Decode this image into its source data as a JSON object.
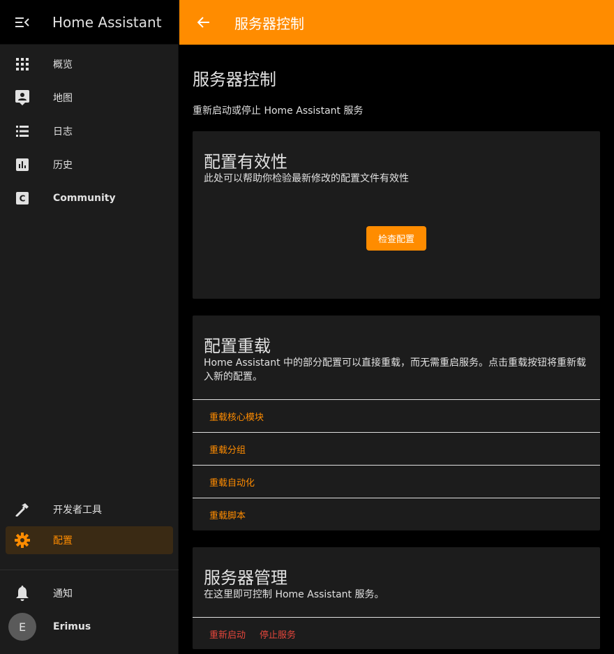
{
  "app": {
    "title": "Home Assistant"
  },
  "sidebar": {
    "items": [
      {
        "label": "概览",
        "icon": "grid-icon"
      },
      {
        "label": "地图",
        "icon": "map-account-icon"
      },
      {
        "label": "日志",
        "icon": "list-icon"
      },
      {
        "label": "历史",
        "icon": "chart-bar-icon"
      },
      {
        "label": "Community",
        "icon": "community-icon"
      }
    ],
    "bottom": [
      {
        "label": "开发者工具",
        "icon": "hammer-icon"
      },
      {
        "label": "配置",
        "icon": "gear-icon",
        "selected": true
      }
    ],
    "notifications_label": "通知",
    "user": {
      "initial": "E",
      "name": "Erimus"
    }
  },
  "header": {
    "title": "服务器控制"
  },
  "page": {
    "title": "服务器控制",
    "description": "重新启动或停止 Home Assistant 服务"
  },
  "validation": {
    "title": "配置有效性",
    "description": "此处可以帮助你检验最新修改的配置文件有效性",
    "button": "检查配置"
  },
  "reloading": {
    "title": "配置重载",
    "description": "Home Assistant 中的部分配置可以直接重载，而无需重启服务。点击重载按钮将重新载入新的配置。",
    "buttons": [
      "重载核心模块",
      "重载分组",
      "重载自动化",
      "重载脚本"
    ]
  },
  "management": {
    "title": "服务器管理",
    "description": "在这里即可控制 Home Assistant 服务。",
    "restart": "重新启动",
    "stop": "停止服务"
  },
  "colors": {
    "accent": "#ff8c00",
    "danger": "#e4463b",
    "sidebar_bg": "#1c1c1c",
    "card_bg": "#1c1c1c"
  }
}
